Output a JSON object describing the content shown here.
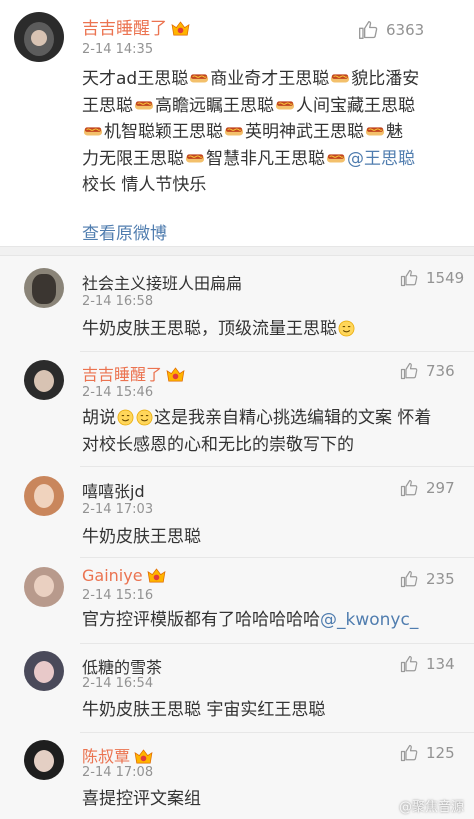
{
  "colors": {
    "vip_name": "#eb7350",
    "link": "#507daf",
    "meta": "#939393",
    "text": "#333333"
  },
  "main_comment": {
    "username": "吉吉睡醒了",
    "time": "2-14 14:35",
    "likes": "6363",
    "line1": [
      "天才ad王思聪",
      "商业奇才王思聪",
      "貌比潘安"
    ],
    "line2": [
      "王思聪",
      "高瞻远瞩王思聪",
      "人间宝藏王思聪"
    ],
    "line3": [
      "机智聪颖王思聪",
      "英明神武王思聪",
      "魅"
    ],
    "line4": [
      "力无限王思聪",
      "智慧非凡王思聪",
      "@王思聪"
    ],
    "line5": "校长 情人节快乐",
    "view_original": "查看原微博"
  },
  "replies": [
    {
      "username": "社会主义接班人田扁扁",
      "time": "2-14 16:58",
      "likes": "1549",
      "text": "牛奶皮肤王思聪，顶级流量王思聪",
      "vip": false
    },
    {
      "username": "吉吉睡醒了",
      "time": "2-14 15:46",
      "likes": "736",
      "text_a": "胡说",
      "text_b": "这是我亲自精心挑选编辑的文案 怀着",
      "text_c": "对校长感恩的心和无比的崇敬写下的",
      "vip": true
    },
    {
      "username": "嘻嘻张jd",
      "time": "2-14 17:03",
      "likes": "297",
      "text": "牛奶皮肤王思聪",
      "vip": false
    },
    {
      "username": "Gainiye",
      "time": "2-14 15:16",
      "likes": "235",
      "text": "官方控评模版都有了哈哈哈哈哈",
      "mention": "@_kwonyc_",
      "vip": true
    },
    {
      "username": "低糖的雪茶",
      "time": "2-14 16:54",
      "likes": "134",
      "text": "牛奶皮肤王思聪 宇宙实红王思聪",
      "vip": false
    },
    {
      "username": "陈叔覃",
      "time": "2-14 17:08",
      "likes": "125",
      "text": "喜提控评文案组",
      "vip": true
    }
  ],
  "watermark": "@聚焦音源",
  "icons": {
    "like": "thumbs-up-icon",
    "vip": "vip-crown-icon",
    "hotdog": "hotdog-emoji-icon",
    "smile": "smile-emoji-icon"
  }
}
